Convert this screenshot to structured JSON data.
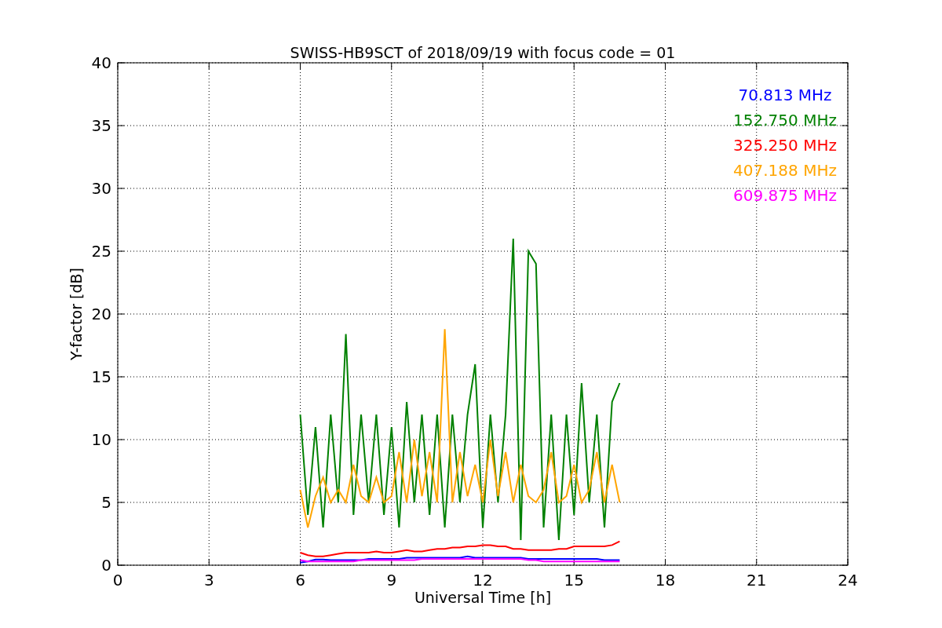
{
  "figure": {
    "chart_data": {
      "type": "line",
      "title": "SWISS-HB9SCT of 2018/09/19 with focus code = 01",
      "xlabel": "Universal Time [h]",
      "ylabel": "Y-factor [dB]",
      "x": [
        6,
        6.25,
        6.5,
        6.75,
        7,
        7.25,
        7.5,
        7.75,
        8,
        8.25,
        8.5,
        8.75,
        9,
        9.25,
        9.5,
        9.75,
        10,
        10.25,
        10.5,
        10.75,
        11,
        11.25,
        11.5,
        11.75,
        12,
        12.25,
        12.5,
        12.75,
        13,
        13.25,
        13.5,
        13.75,
        14,
        14.25,
        14.5,
        14.75,
        15,
        15.25,
        15.5,
        15.75,
        16,
        16.25,
        16.5
      ],
      "series": [
        {
          "name": "70.813 MHz",
          "color": "#0000ff",
          "values": [
            0.2,
            0.3,
            0.45,
            0.45,
            0.4,
            0.4,
            0.4,
            0.4,
            0.4,
            0.5,
            0.5,
            0.5,
            0.5,
            0.5,
            0.6,
            0.6,
            0.6,
            0.6,
            0.6,
            0.6,
            0.6,
            0.6,
            0.7,
            0.6,
            0.6,
            0.6,
            0.6,
            0.6,
            0.6,
            0.6,
            0.5,
            0.5,
            0.5,
            0.5,
            0.5,
            0.5,
            0.5,
            0.5,
            0.5,
            0.5,
            0.4,
            0.4,
            0.4
          ]
        },
        {
          "name": "152.750 MHz",
          "color": "#008000",
          "values": [
            12,
            4,
            11,
            3,
            12,
            5,
            18.4,
            4,
            12,
            5,
            12,
            4,
            11,
            3,
            13,
            5,
            12,
            4,
            12,
            3,
            12,
            5,
            12,
            16,
            3,
            12,
            5,
            12,
            26,
            2,
            25,
            24,
            3,
            12,
            2,
            12,
            4,
            14.5,
            5,
            12,
            3,
            13,
            14.5
          ]
        },
        {
          "name": "325.250 MHz",
          "color": "#ff0000",
          "values": [
            1.0,
            0.8,
            0.7,
            0.7,
            0.8,
            0.9,
            1.0,
            1.0,
            1.0,
            1.0,
            1.1,
            1.0,
            1.0,
            1.1,
            1.2,
            1.1,
            1.1,
            1.2,
            1.3,
            1.3,
            1.4,
            1.4,
            1.5,
            1.5,
            1.6,
            1.6,
            1.5,
            1.5,
            1.3,
            1.3,
            1.2,
            1.2,
            1.2,
            1.2,
            1.3,
            1.3,
            1.5,
            1.5,
            1.5,
            1.5,
            1.5,
            1.6,
            1.9
          ]
        },
        {
          "name": "407.188 MHz",
          "color": "#ffa500",
          "values": [
            6,
            3,
            5.5,
            7,
            5,
            6,
            5,
            8,
            5.5,
            5,
            7,
            5,
            5.5,
            9,
            5,
            10,
            5.5,
            9,
            5,
            18.8,
            5,
            9,
            5.5,
            8,
            5,
            10,
            5.5,
            9,
            5,
            8,
            5.5,
            5,
            6,
            9,
            5,
            5.5,
            8,
            5,
            6,
            9,
            5,
            8,
            5
          ]
        },
        {
          "name": "609.875 MHz",
          "color": "#ff00ff",
          "values": [
            0.4,
            0.3,
            0.3,
            0.3,
            0.3,
            0.3,
            0.3,
            0.3,
            0.4,
            0.4,
            0.4,
            0.4,
            0.4,
            0.4,
            0.4,
            0.4,
            0.5,
            0.5,
            0.5,
            0.5,
            0.5,
            0.5,
            0.5,
            0.5,
            0.5,
            0.5,
            0.5,
            0.5,
            0.5,
            0.5,
            0.4,
            0.4,
            0.3,
            0.3,
            0.3,
            0.3,
            0.3,
            0.3,
            0.3,
            0.3,
            0.3,
            0.3,
            0.3
          ]
        }
      ],
      "xlim": [
        0,
        24
      ],
      "ylim": [
        0,
        40
      ],
      "xticks": [
        0,
        3,
        6,
        9,
        12,
        15,
        18,
        21,
        24
      ],
      "yticks": [
        0,
        5,
        10,
        15,
        20,
        25,
        30,
        35,
        40
      ],
      "grid": true
    }
  }
}
